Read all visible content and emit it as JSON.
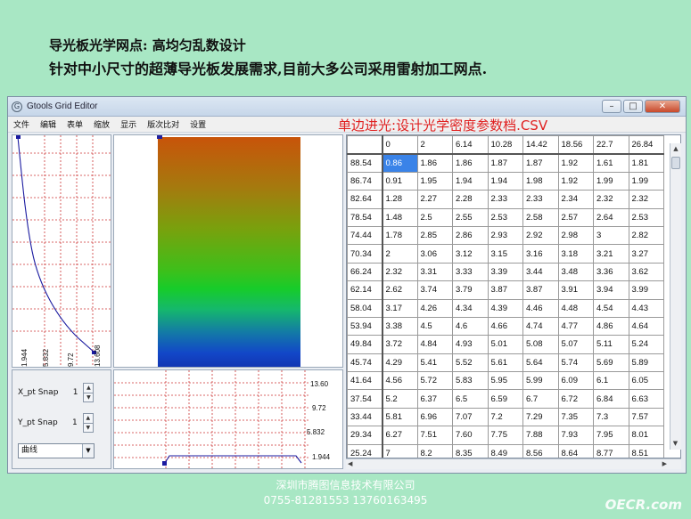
{
  "slide": {
    "heading1": "导光板光学网点: 高均匀乱数设计",
    "heading2": "针对中小尺寸的超薄导光板发展需求,目前大多公司采用雷射加工网点.",
    "footer_company": "深圳市腾图信息技术有限公司",
    "footer_phone": "0755-81281553   13760163495",
    "watermark": "OECR.com"
  },
  "window": {
    "title": "Gtools Grid Editor",
    "buttons": {
      "minimize": "–",
      "maximize": "□",
      "close": "✕"
    },
    "menu": [
      "文件",
      "编辑",
      "表单",
      "缩放",
      "显示",
      "版次比对",
      "设置"
    ],
    "csv_label_red": "单边进光:",
    "csv_label_rest": "设计光学密度参数档.CSV",
    "controls": {
      "x_snap_label": "X_pt Snap",
      "x_snap_value": "1",
      "y_snap_label": "Y_pt Snap",
      "y_snap_value": "1",
      "curve_mode": "曲线"
    },
    "left_axis_labels": [
      "1.944",
      "5.832",
      "9.72",
      "13.608"
    ],
    "bottom_axis_labels": [
      "13.60",
      "9.72",
      "5.832",
      "1.944"
    ]
  },
  "grid": {
    "columns": [
      "0",
      "2",
      "6.14",
      "10.28",
      "14.42",
      "18.56",
      "22.7",
      "26.84"
    ],
    "rows": [
      {
        "h": "88.54",
        "v": [
          "0.86",
          "1.86",
          "1.86",
          "1.87",
          "1.87",
          "1.92",
          "1.61",
          "1.81"
        ]
      },
      {
        "h": "86.74",
        "v": [
          "0.91",
          "1.95",
          "1.94",
          "1.94",
          "1.98",
          "1.92",
          "1.99",
          "1.99"
        ]
      },
      {
        "h": "82.64",
        "v": [
          "1.28",
          "2.27",
          "2.28",
          "2.33",
          "2.33",
          "2.34",
          "2.32",
          "2.32"
        ]
      },
      {
        "h": "78.54",
        "v": [
          "1.48",
          "2.5",
          "2.55",
          "2.53",
          "2.58",
          "2.57",
          "2.64",
          "2.53"
        ]
      },
      {
        "h": "74.44",
        "v": [
          "1.78",
          "2.85",
          "2.86",
          "2.93",
          "2.92",
          "2.98",
          "3",
          "2.82"
        ]
      },
      {
        "h": "70.34",
        "v": [
          "2",
          "3.06",
          "3.12",
          "3.15",
          "3.16",
          "3.18",
          "3.21",
          "3.27"
        ]
      },
      {
        "h": "66.24",
        "v": [
          "2.32",
          "3.31",
          "3.33",
          "3.39",
          "3.44",
          "3.48",
          "3.36",
          "3.62"
        ]
      },
      {
        "h": "62.14",
        "v": [
          "2.62",
          "3.74",
          "3.79",
          "3.87",
          "3.87",
          "3.91",
          "3.94",
          "3.99"
        ]
      },
      {
        "h": "58.04",
        "v": [
          "3.17",
          "4.26",
          "4.34",
          "4.39",
          "4.46",
          "4.48",
          "4.54",
          "4.43"
        ]
      },
      {
        "h": "53.94",
        "v": [
          "3.38",
          "4.5",
          "4.6",
          "4.66",
          "4.74",
          "4.77",
          "4.86",
          "4.64"
        ]
      },
      {
        "h": "49.84",
        "v": [
          "3.72",
          "4.84",
          "4.93",
          "5.01",
          "5.08",
          "5.07",
          "5.11",
          "5.24"
        ]
      },
      {
        "h": "45.74",
        "v": [
          "4.29",
          "5.41",
          "5.52",
          "5.61",
          "5.64",
          "5.74",
          "5.69",
          "5.89"
        ]
      },
      {
        "h": "41.64",
        "v": [
          "4.56",
          "5.72",
          "5.83",
          "5.95",
          "5.99",
          "6.09",
          "6.1",
          "6.05"
        ]
      },
      {
        "h": "37.54",
        "v": [
          "5.2",
          "6.37",
          "6.5",
          "6.59",
          "6.7",
          "6.72",
          "6.84",
          "6.63"
        ]
      },
      {
        "h": "33.44",
        "v": [
          "5.81",
          "6.96",
          "7.07",
          "7.2",
          "7.29",
          "7.35",
          "7.3",
          "7.57"
        ]
      },
      {
        "h": "29.34",
        "v": [
          "6.27",
          "7.51",
          "7.60",
          "7.75",
          "7.88",
          "7.93",
          "7.95",
          "8.01"
        ]
      },
      {
        "h": "25.24",
        "v": [
          "7",
          "8.2",
          "8.35",
          "8.49",
          "8.56",
          "8.64",
          "8.77",
          "8.51"
        ]
      }
    ],
    "selected": {
      "row": 0,
      "col": 0
    }
  }
}
